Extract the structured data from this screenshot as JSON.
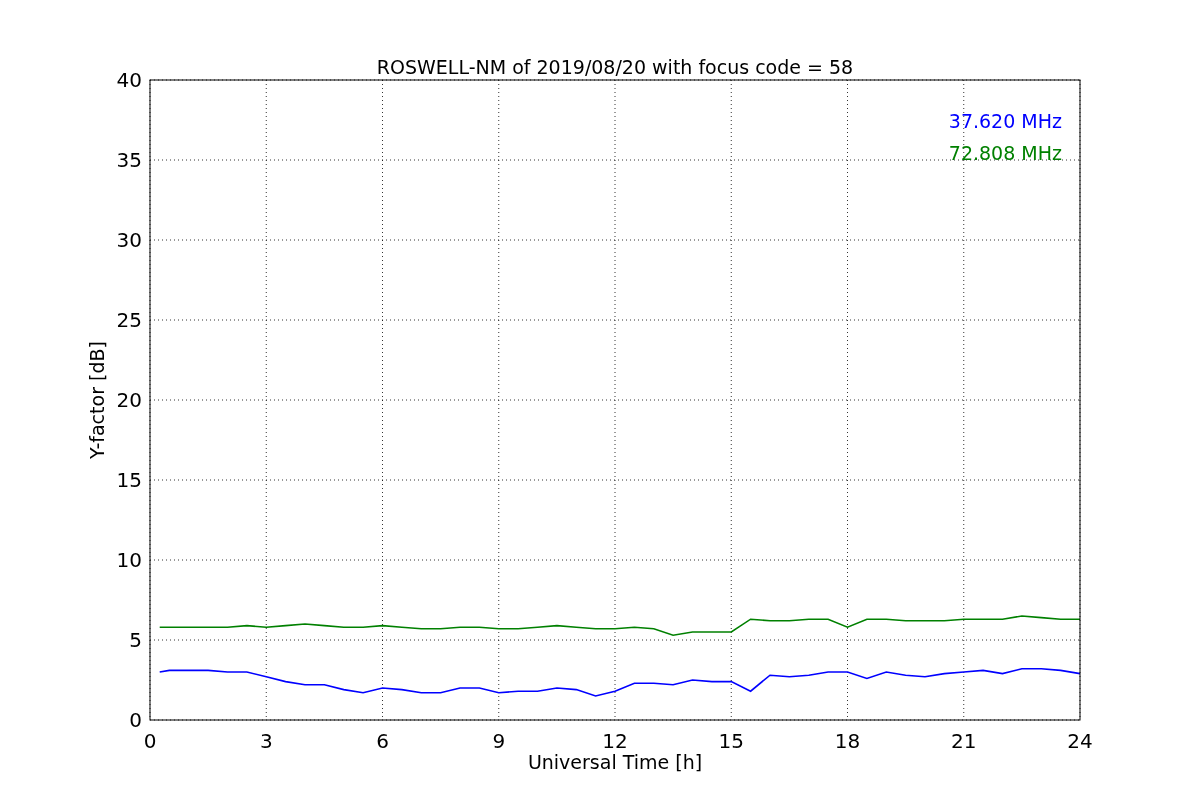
{
  "chart_data": {
    "type": "line",
    "title": "ROSWELL-NM of 2019/08/20 with focus code = 58",
    "xlabel": "Universal Time [h]",
    "ylabel": "Y-factor [dB]",
    "x": [
      0.25,
      0.5,
      1,
      1.5,
      2,
      2.5,
      3,
      3.5,
      4,
      4.5,
      5,
      5.5,
      6,
      6.5,
      7,
      7.5,
      8,
      8.5,
      9,
      9.5,
      10,
      10.5,
      11,
      11.5,
      12,
      12.5,
      13,
      13.5,
      14,
      14.5,
      15,
      15.5,
      16,
      16.5,
      17,
      17.5,
      18,
      18.5,
      19,
      19.5,
      20,
      20.5,
      21,
      21.5,
      22,
      22.5,
      23,
      23.5,
      24
    ],
    "series": [
      {
        "name": "37.620 MHz",
        "color": "#0000ff",
        "values": [
          3.0,
          3.1,
          3.1,
          3.1,
          3.0,
          3.0,
          2.7,
          2.4,
          2.2,
          2.2,
          1.9,
          1.7,
          2.0,
          1.9,
          1.7,
          1.7,
          2.0,
          2.0,
          1.7,
          1.8,
          1.8,
          2.0,
          1.9,
          1.5,
          1.8,
          2.3,
          2.3,
          2.2,
          2.5,
          2.4,
          2.4,
          1.8,
          2.8,
          2.7,
          2.8,
          3.0,
          3.0,
          2.6,
          3.0,
          2.8,
          2.7,
          2.9,
          3.0,
          3.1,
          2.9,
          3.2,
          3.2,
          3.1,
          2.9
        ]
      },
      {
        "name": "72.808 MHz",
        "color": "#008000",
        "values": [
          5.8,
          5.8,
          5.8,
          5.8,
          5.8,
          5.9,
          5.8,
          5.9,
          6.0,
          5.9,
          5.8,
          5.8,
          5.9,
          5.8,
          5.7,
          5.7,
          5.8,
          5.8,
          5.7,
          5.7,
          5.8,
          5.9,
          5.8,
          5.7,
          5.7,
          5.8,
          5.7,
          5.3,
          5.5,
          5.5,
          5.5,
          6.3,
          6.2,
          6.2,
          6.3,
          6.3,
          5.8,
          6.3,
          6.3,
          6.2,
          6.2,
          6.2,
          6.3,
          6.3,
          6.3,
          6.5,
          6.4,
          6.3,
          6.3
        ]
      }
    ],
    "grid": true,
    "xlim": [
      0,
      24
    ],
    "ylim": [
      0,
      40
    ],
    "xticks": [
      0,
      3,
      6,
      9,
      12,
      15,
      18,
      21,
      24
    ],
    "yticks": [
      0,
      5,
      10,
      15,
      20,
      25,
      30,
      35,
      40
    ]
  }
}
